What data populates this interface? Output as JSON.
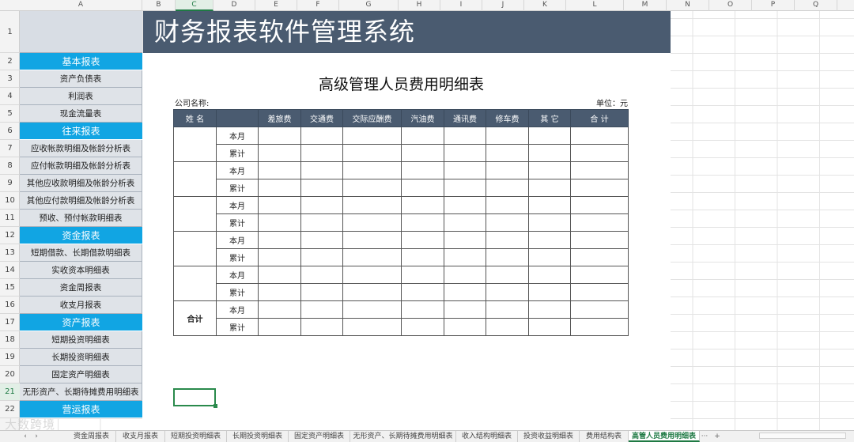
{
  "columns": [
    "A",
    "B",
    "C",
    "D",
    "E",
    "F",
    "G",
    "H",
    "I",
    "J",
    "K",
    "L",
    "M",
    "N",
    "O",
    "P",
    "Q"
  ],
  "selected_column": "C",
  "rows": [
    "1",
    "2",
    "3",
    "4",
    "5",
    "6",
    "7",
    "8",
    "9",
    "10",
    "11",
    "12",
    "13",
    "14",
    "15",
    "16",
    "17",
    "18",
    "19",
    "20",
    "21",
    "22"
  ],
  "selected_row": "21",
  "banner_title": "财务报表软件管理系统",
  "sidebar": [
    {
      "type": "cat",
      "label": "基本报表"
    },
    {
      "type": "item",
      "label": "资产负债表"
    },
    {
      "type": "item",
      "label": "利润表"
    },
    {
      "type": "item",
      "label": "现金流量表"
    },
    {
      "type": "cat",
      "label": "往来报表"
    },
    {
      "type": "item",
      "label": "应收帐款明细及帐龄分析表"
    },
    {
      "type": "item",
      "label": "应付帐款明细及帐龄分析表"
    },
    {
      "type": "item",
      "label": "其他应收款明细及帐龄分析表"
    },
    {
      "type": "item",
      "label": "其他应付款明细及帐龄分析表"
    },
    {
      "type": "item",
      "label": "预收、预付帐款明细表"
    },
    {
      "type": "cat",
      "label": "资金报表"
    },
    {
      "type": "item",
      "label": "短期借款、长期借款明细表"
    },
    {
      "type": "item",
      "label": "实收资本明细表"
    },
    {
      "type": "item",
      "label": "资金周报表"
    },
    {
      "type": "item",
      "label": "收支月报表"
    },
    {
      "type": "cat",
      "label": "资产报表"
    },
    {
      "type": "item",
      "label": "短期投资明细表"
    },
    {
      "type": "item",
      "label": "长期投资明细表"
    },
    {
      "type": "item",
      "label": "固定资产明细表"
    },
    {
      "type": "item",
      "label": "无形资产、长期待摊费用明细表"
    },
    {
      "type": "cat",
      "label": "营运报表"
    }
  ],
  "report": {
    "title": "高级管理人员费用明细表",
    "company_label": "公司名称:",
    "unit_label": "单位：元",
    "headers": [
      "姓  名",
      "",
      "差旅费",
      "交通费",
      "交际应酬费",
      "汽油费",
      "通讯费",
      "修车费",
      "其  它",
      "合  计"
    ],
    "period_labels": [
      "本月",
      "累计"
    ],
    "total_label": "合计",
    "person_rows": 5
  },
  "sheet_tabs": [
    "资金周报表",
    "收支月报表",
    "短期投资明细表",
    "长期投资明细表",
    "固定资产明细表",
    "无形资产、长期待摊费用明细表",
    "收入结构明细表",
    "投资收益明细表",
    "费用结构表",
    "高管人员费用明细表"
  ],
  "active_tab": "高管人员费用明细表",
  "tab_more": "···",
  "tab_add": "+",
  "watermark": "大数跨境",
  "colors": {
    "banner": "#4a5b70",
    "category": "#11a5e3",
    "accent": "#1f7a44"
  }
}
